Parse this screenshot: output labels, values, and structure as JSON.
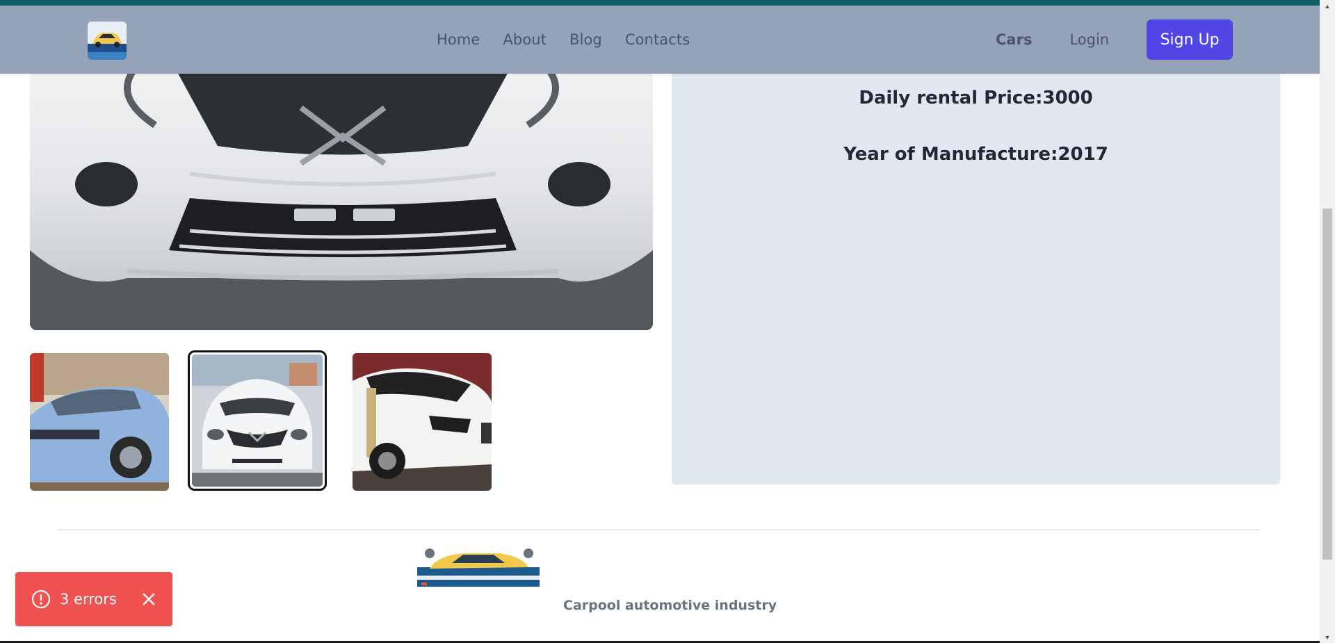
{
  "header": {
    "logo_icon": "car-logo-icon",
    "nav": {
      "home": "Home",
      "about": "About",
      "blog": "Blog",
      "contacts": "Contacts"
    },
    "cars": "Cars",
    "login": "Login",
    "signup": "Sign Up"
  },
  "details": {
    "price_line": "Daily rental Price:3000",
    "year_line": "Year of Manufacture:2017"
  },
  "gallery": {
    "thumbnails": [
      {
        "name": "blue-car-thumbnail",
        "selected": false
      },
      {
        "name": "white-car-front-thumbnail",
        "selected": true
      },
      {
        "name": "white-car-rear-thumbnail",
        "selected": false
      }
    ]
  },
  "footer": {
    "logo_icon": "car-logo-icon",
    "tagline": "Carpool automotive industry"
  },
  "toast": {
    "label": "3 errors",
    "icon": "alert-circle-icon",
    "close_icon": "close-icon"
  },
  "colors": {
    "accent_bar": "#0f5e63",
    "navbar": "#94a3b8",
    "primary": "#4f46e5",
    "panel": "#e2e8f0",
    "error": "#f05252"
  }
}
